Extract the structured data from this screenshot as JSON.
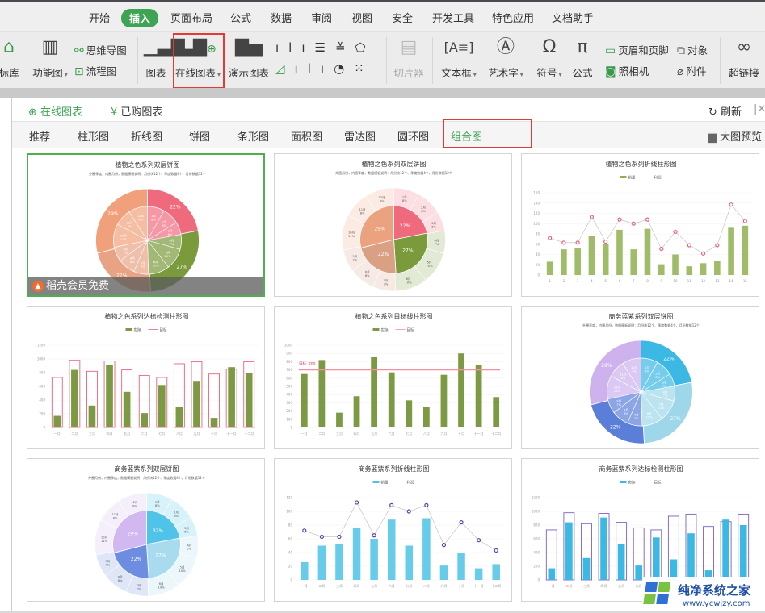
{
  "menu": {
    "tabs": [
      "开始",
      "插入",
      "页面布局",
      "公式",
      "数据",
      "审阅",
      "视图",
      "安全",
      "开发工具",
      "特色应用",
      "文档助手"
    ],
    "active": "插入"
  },
  "ribbon": {
    "icon_library": "标库",
    "function_chart": "功能图",
    "mind_map": "思维导图",
    "flowchart": "流程图",
    "chart": "图表",
    "online_chart": "在线图表",
    "demo_chart": "演示图表",
    "slicer": "切片器",
    "textbox": "文本框",
    "wordart": "艺术字",
    "symbol": "符号",
    "formula": "公式",
    "header_footer": "页眉和页脚",
    "camera": "照相机",
    "object": "对象",
    "attachment": "附件",
    "hyperlink": "超链接"
  },
  "panel": {
    "tabs": [
      "在线图表",
      "已购图表"
    ],
    "active_tab": "在线图表",
    "refresh": "刷新",
    "categories": [
      "推荐",
      "柱形图",
      "折线图",
      "饼图",
      "条形图",
      "面积图",
      "雷达图",
      "圆环图",
      "组合图"
    ],
    "active_category": "组合图",
    "preview": "大图预览",
    "member_badge": "稻壳会员免费"
  },
  "accent": "#3ea352",
  "watermark": {
    "name": "纯净系统之家",
    "url": "www.ycwjzy.com"
  },
  "chart_data": [
    {
      "type": "pie",
      "variant": "double-pie",
      "title": "植物之色系列双层饼图",
      "subtitle": "外圈季度，内圈月份，数据模板说明：月份块12个、季度数据4个，月份数据12个",
      "outer": {
        "values": [
          22,
          27,
          22,
          29
        ],
        "labels": [
          "22%",
          "27%",
          "22%",
          "29%"
        ],
        "colors": [
          "#f06a7e",
          "#7a9a3c",
          "#e8a385",
          "#f0a07a"
        ]
      },
      "inner": {
        "labels": [
          "1月",
          "2月",
          "3月",
          "4月",
          "5月",
          "6月",
          "7月",
          "8月",
          "9月",
          "10月",
          "11月",
          "12月"
        ],
        "values": [
          8,
          8,
          6,
          7,
          10,
          10,
          7,
          8,
          7,
          11,
          8,
          9
        ]
      }
    },
    {
      "type": "pie",
      "variant": "donut-ring",
      "title": "植物之色系列双层饼图",
      "subtitle": "外圈月份，内圈季度，数据模板说明：月份块12个、季度数据4个，月份数据12个",
      "outer": {
        "values": [
          22,
          27,
          22,
          29
        ],
        "labels": [
          "22%",
          "27%",
          "22%",
          "29%"
        ],
        "colors": [
          "#f06a7e",
          "#7a9a3c",
          "#d9a083",
          "#eba37f"
        ]
      },
      "inner": {
        "labels": [
          "1月",
          "2月",
          "3月",
          "4月",
          "5月",
          "6月",
          "7月",
          "8月",
          "9月",
          "10月",
          "11月",
          "12月"
        ],
        "values": [
          8,
          8,
          6,
          7,
          10,
          10,
          7,
          8,
          7,
          11,
          8,
          9
        ]
      }
    },
    {
      "type": "bar-line",
      "title": "植物之色系列折线柱形图",
      "legend": [
        "销量",
        "利润"
      ],
      "colors": [
        "#8fb04f",
        "#e8627a"
      ],
      "categories": [
        "1",
        "2",
        "3",
        "4",
        "5",
        "6",
        "7",
        "8",
        "9",
        "10",
        "11",
        "12",
        "13",
        "14",
        "15"
      ],
      "bars": [
        26,
        50,
        53,
        76,
        60,
        88,
        50,
        90,
        21,
        40,
        17,
        23,
        27,
        92,
        96
      ],
      "line": [
        72,
        63,
        63,
        113,
        65,
        108,
        100,
        108,
        51,
        84,
        58,
        42,
        58,
        137,
        105
      ],
      "ylim": [
        0,
        160
      ],
      "yticks": [
        0,
        20,
        40,
        60,
        80,
        100,
        120,
        140,
        160
      ]
    },
    {
      "type": "target-bar",
      "title": "植物之色系列达标检测柱形图",
      "legend": [
        "实际",
        "目标"
      ],
      "colors": [
        "#7c9a43",
        "#e8627a"
      ],
      "categories": [
        "一月",
        "二月",
        "三月",
        "四月",
        "五月",
        "六月",
        "七月",
        "八月",
        "九月",
        "十月",
        "十一月",
        "十二月"
      ],
      "actual": [
        170,
        840,
        320,
        910,
        520,
        210,
        620,
        300,
        680,
        140,
        880,
        800
      ],
      "target": [
        730,
        980,
        820,
        970,
        840,
        760,
        730,
        930,
        960,
        780,
        850,
        960
      ],
      "ylim": [
        0,
        1200
      ],
      "yticks": [
        0,
        200,
        400,
        600,
        800,
        1000,
        1200
      ]
    },
    {
      "type": "bar-target-line",
      "title": "植物之色系列目标线柱形图",
      "legend": [
        "实际",
        "目标"
      ],
      "colors": [
        "#7c9a43",
        "#f48fa0"
      ],
      "categories": [
        "一月",
        "二月",
        "三月",
        "四月",
        "五月",
        "六月",
        "七月",
        "八月",
        "九月",
        "十月",
        "十一月",
        "十二月"
      ],
      "values": [
        650,
        820,
        180,
        380,
        860,
        670,
        330,
        250,
        640,
        900,
        760,
        370
      ],
      "target": 700,
      "target_label": "目标: 700",
      "ylim": [
        0,
        1000
      ],
      "yticks": [
        0,
        100,
        200,
        300,
        400,
        500,
        600,
        700,
        800,
        900,
        1000
      ]
    },
    {
      "type": "pie",
      "variant": "double-pie",
      "title": "商务蓝紫系列双层饼图",
      "subtitle": "外圈季度，内圈月份，数据模板说明：月份块12个、季度数据4个，月份数据12个",
      "outer": {
        "values": [
          22,
          27,
          22,
          29
        ],
        "labels": [
          "22%",
          "27%",
          "22%",
          "29%"
        ],
        "colors": [
          "#3bb8e3",
          "#9fd7ea",
          "#5b7fd8",
          "#cdb2ee"
        ]
      },
      "inner": {
        "labels": [
          "1月",
          "2月",
          "3月",
          "4月",
          "5月",
          "6月",
          "7月",
          "8月",
          "9月",
          "10月",
          "11月",
          "12月"
        ],
        "values": [
          8,
          8,
          6,
          7,
          10,
          10,
          7,
          8,
          7,
          11,
          8,
          9
        ]
      }
    },
    {
      "type": "pie",
      "variant": "donut-ring",
      "title": "商务蓝紫系列双层饼图",
      "subtitle": "外圈月份，内圈季度，数据模板说明：月份块12个、季度数据4个，月份数据12个",
      "outer": {
        "values": [
          22,
          27,
          22,
          29
        ],
        "labels": [
          "32%",
          "27%",
          "22%",
          "29%"
        ],
        "colors": [
          "#4fc3e8",
          "#a9dbee",
          "#6d8ee0",
          "#d2b8f0"
        ]
      },
      "inner": {
        "labels": [
          "1月",
          "2月",
          "3月",
          "4月",
          "5月",
          "6月",
          "7月",
          "8月",
          "9月",
          "10月",
          "11月",
          "12月"
        ],
        "values": [
          8,
          8,
          6,
          7,
          10,
          10,
          7,
          8,
          7,
          11,
          8,
          9
        ]
      }
    },
    {
      "type": "bar-line",
      "title": "商务蓝紫系列折线柱形图",
      "legend": [
        "销量",
        "利润"
      ],
      "colors": [
        "#4cc3e6",
        "#5a3fb0"
      ],
      "categories": [
        "一月",
        "二月",
        "三月",
        "四月",
        "五月",
        "六月",
        "七月",
        "八月",
        "九月",
        "十月",
        "十一月",
        "十二月"
      ],
      "bars": [
        26,
        50,
        53,
        76,
        60,
        88,
        50,
        90,
        21,
        40,
        17,
        23
      ],
      "line": [
        72,
        63,
        63,
        113,
        65,
        109,
        100,
        109,
        51,
        84,
        58,
        43
      ],
      "ylim": [
        0,
        120
      ],
      "yticks": [
        0,
        20,
        40,
        60,
        80,
        100,
        120
      ]
    },
    {
      "type": "target-bar",
      "title": "商务蓝紫系列达标检测柱形图",
      "legend": [
        "实际",
        "目标"
      ],
      "colors": [
        "#3bb8e3",
        "#7b5fc0"
      ],
      "categories": [
        "一月",
        "二月",
        "三月",
        "四月",
        "五月",
        "六月",
        "七月",
        "八月",
        "九月",
        "十月",
        "十一月",
        "十二月"
      ],
      "actual": [
        170,
        840,
        320,
        910,
        520,
        210,
        620,
        300,
        680,
        140,
        880,
        800
      ],
      "target": [
        730,
        980,
        820,
        970,
        840,
        760,
        730,
        930,
        960,
        780,
        850,
        960
      ],
      "ylim": [
        0,
        1200
      ],
      "yticks": [
        0,
        200,
        400,
        600,
        800,
        1000,
        1200
      ]
    }
  ]
}
